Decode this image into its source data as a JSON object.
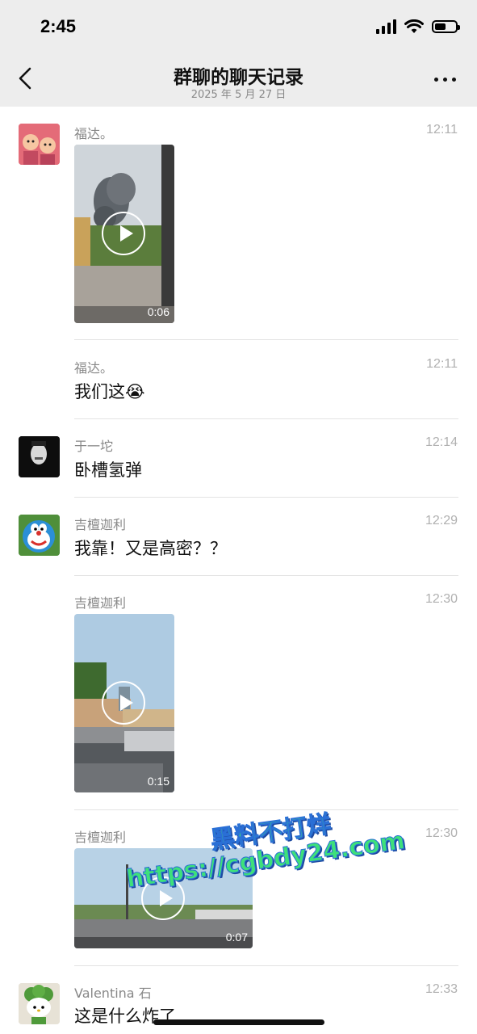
{
  "status_bar": {
    "time": "2:45"
  },
  "header": {
    "title": "群聊的聊天记录",
    "subtitle": "2025 年 5 月 27 日"
  },
  "messages": [
    {
      "name": "福达。",
      "time": "12:11",
      "type": "video",
      "duration": "0:06"
    },
    {
      "name": "福达。",
      "time": "12:11",
      "type": "text",
      "text": "我们这",
      "emoji": "😭"
    },
    {
      "name": "于一坨",
      "time": "12:14",
      "type": "text",
      "text": "卧槽氢弹"
    },
    {
      "name": "吉檀迦利",
      "time": "12:29",
      "type": "text",
      "text": "我靠！又是高密？？"
    },
    {
      "name": "吉檀迦利",
      "time": "12:30",
      "type": "video",
      "duration": "0:15"
    },
    {
      "name": "吉檀迦利",
      "time": "12:30",
      "type": "video",
      "duration": "0:07"
    },
    {
      "name": "Valentina 石",
      "time": "12:33",
      "type": "text",
      "text": "这是什么炸了"
    }
  ],
  "watermark": {
    "line1": "黑料不打烊",
    "line2": "https://cgbdy24.com"
  }
}
